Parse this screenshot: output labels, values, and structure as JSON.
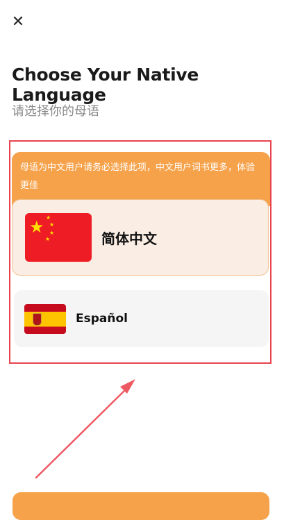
{
  "header": {
    "close_icon": "close-icon",
    "close_glyph": "✕"
  },
  "title": "Choose Your Native Language",
  "subtitle": "请选择你的母语",
  "notice": {
    "text": "母语为中文用户请务必选择此项，中文用户词书更多，体验更佳"
  },
  "languages": [
    {
      "label": "简体中文",
      "flag_icon": "china-flag-icon",
      "selected": true
    },
    {
      "label": "Español",
      "flag_icon": "spain-flag-icon",
      "selected": false
    }
  ],
  "colors": {
    "accent": "#f6a24a",
    "highlight_border": "#e8424f",
    "selected_card_bg": "#f9ede4",
    "card_bg": "#f5f5f6"
  }
}
